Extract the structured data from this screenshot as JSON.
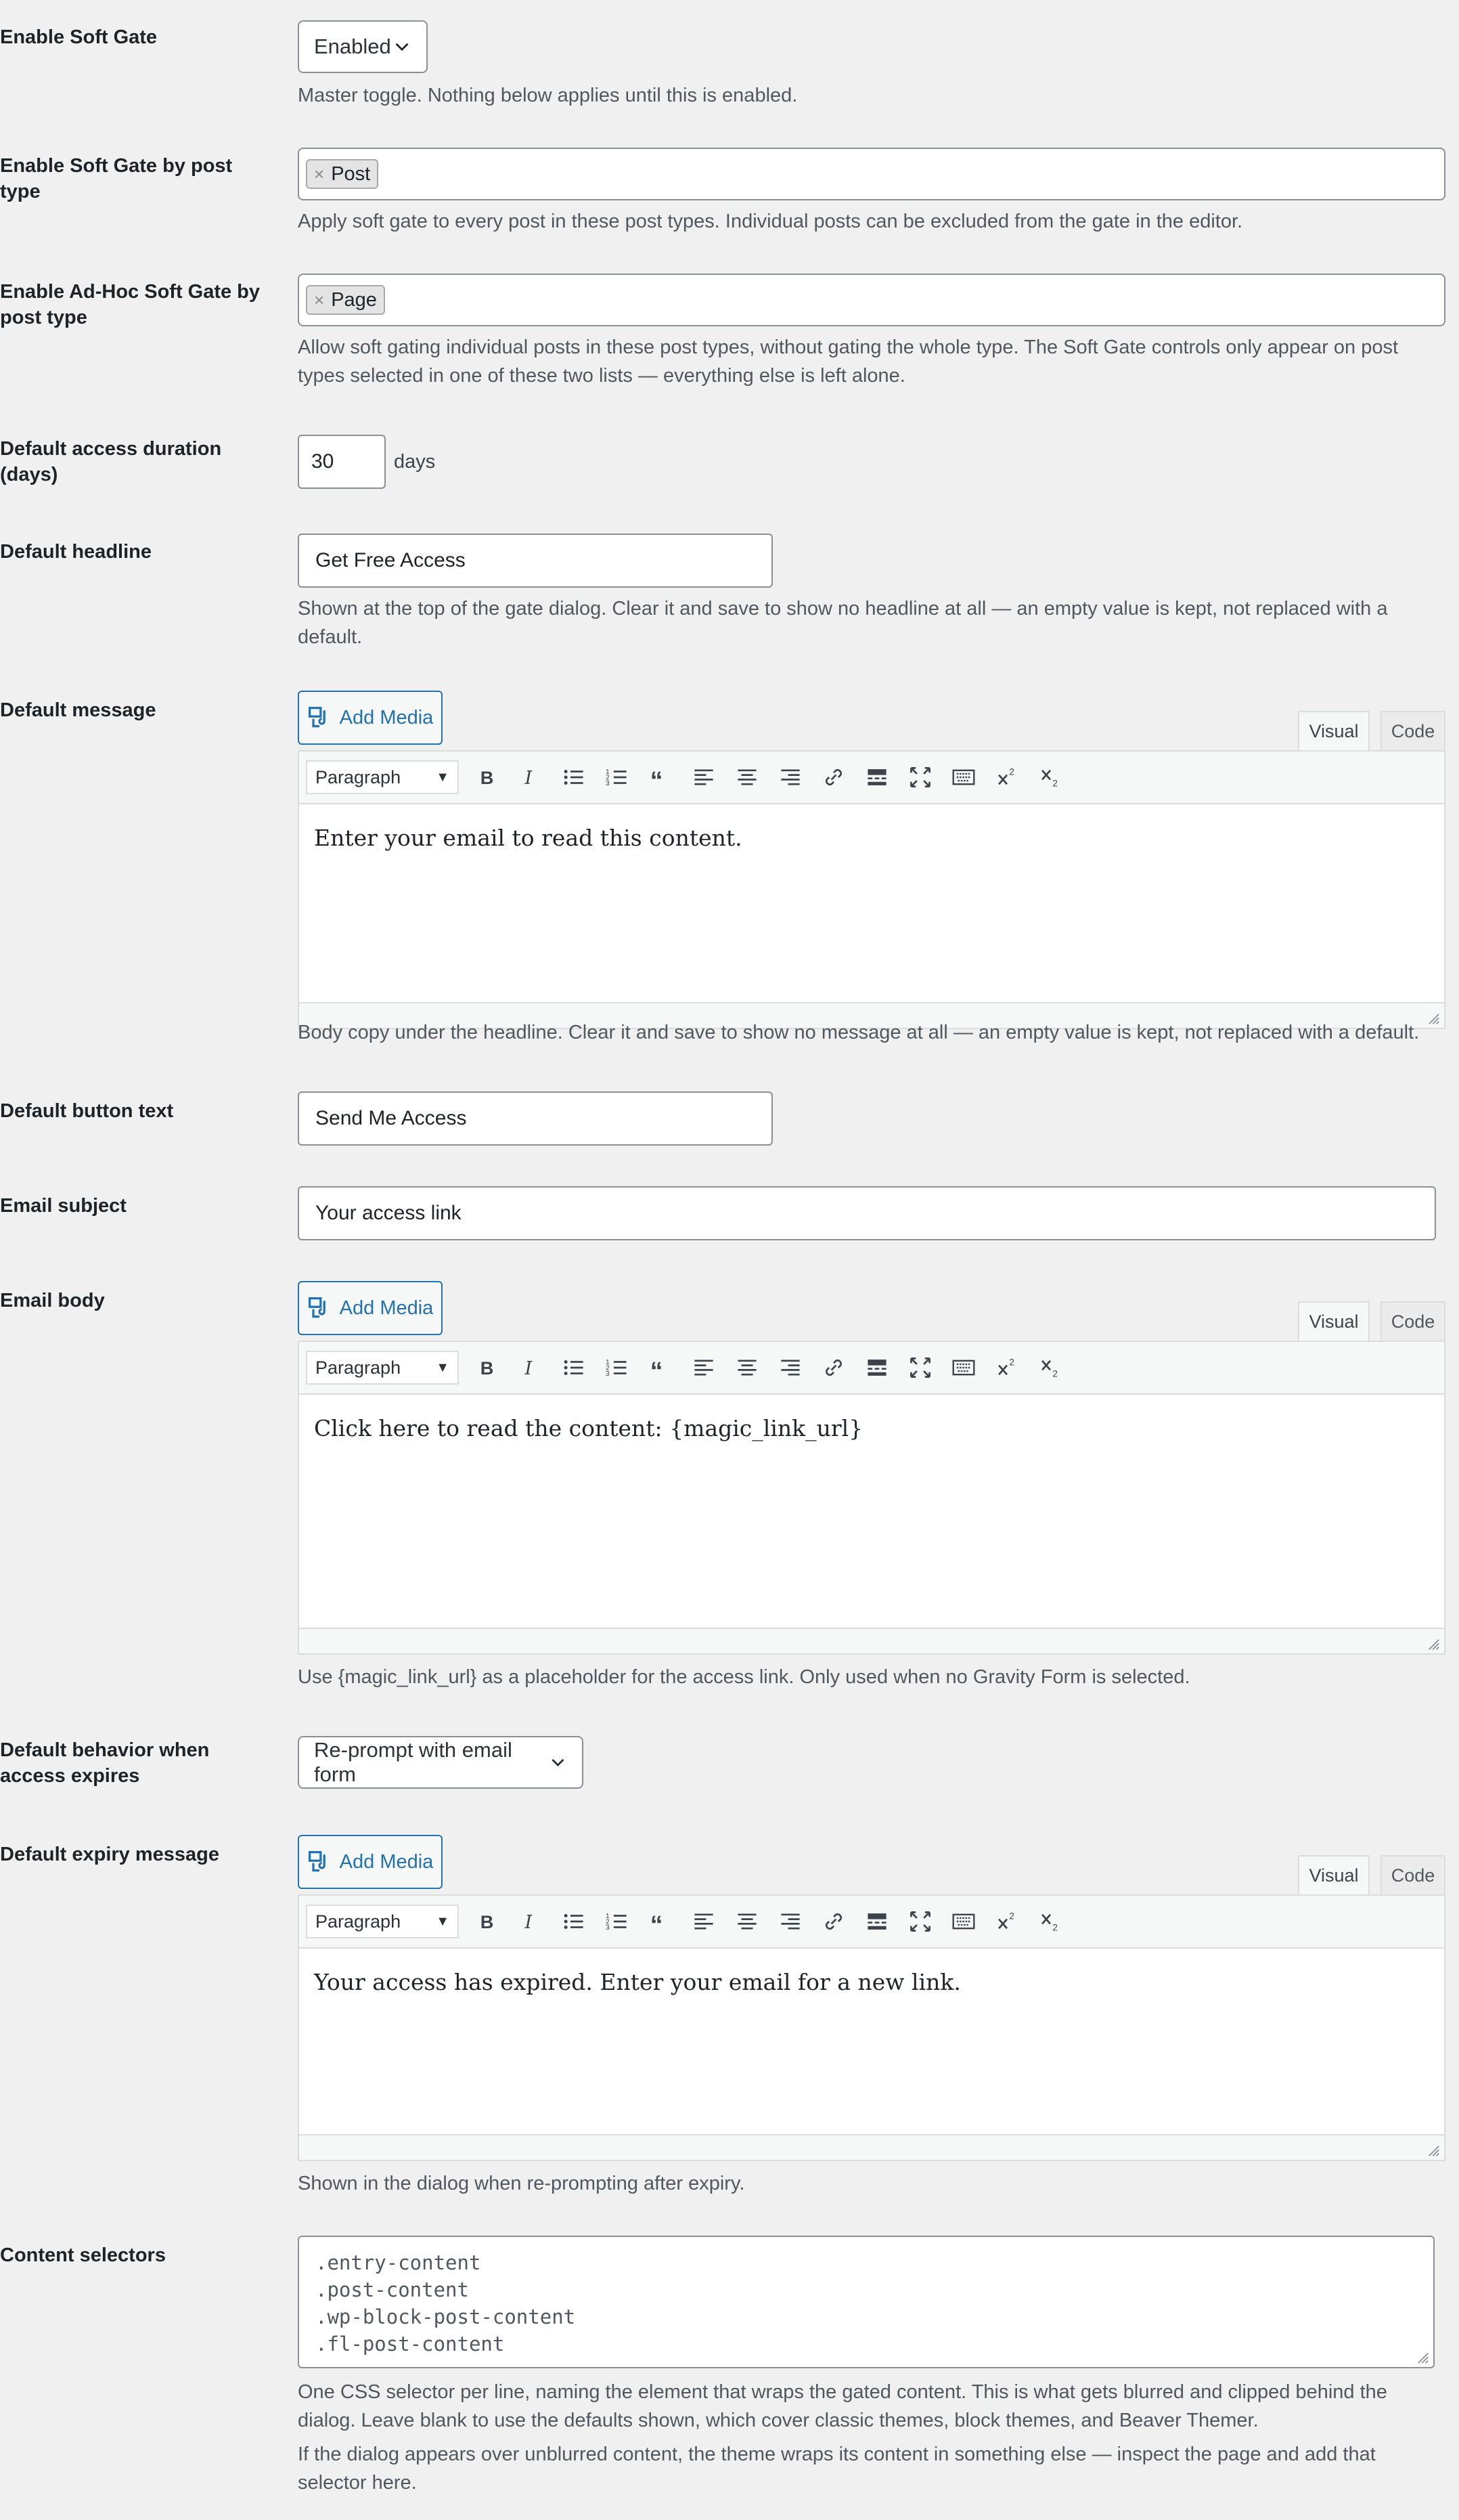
{
  "enable_soft_gate": {
    "label": "Enable Soft Gate",
    "value": "Enabled",
    "desc": "Master toggle. Nothing below applies until this is enabled."
  },
  "post_type_gate": {
    "label": "Enable Soft Gate by post type",
    "tokens": [
      "Post"
    ],
    "desc": "Apply soft gate to every post in these post types. Individual posts can be excluded from the gate in the editor."
  },
  "adhoc_gate": {
    "label": "Enable Ad-Hoc Soft Gate by post type",
    "tokens": [
      "Page"
    ],
    "desc": "Allow soft gating individual posts in these post types, without gating the whole type. The Soft Gate controls only appear on post types selected in one of these two lists — everything else is left alone."
  },
  "duration": {
    "label": "Default access duration (days)",
    "value": "30",
    "unit": "days"
  },
  "headline": {
    "label": "Default headline",
    "value": "Get Free Access",
    "desc": "Shown at the top of the gate dialog. Clear it and save to show no headline at all — an empty value is kept, not replaced with a default."
  },
  "message": {
    "label": "Default message",
    "content": "Enter your email to read this content.",
    "desc": "Body copy under the headline. Clear it and save to show no message at all — an empty value is kept, not replaced with a default."
  },
  "button_text": {
    "label": "Default button text",
    "value": "Send Me Access"
  },
  "email_subject": {
    "label": "Email subject",
    "value": "Your access link"
  },
  "email_body": {
    "label": "Email body",
    "content": "Click here to read the content: {magic_link_url}",
    "desc": "Use {magic_link_url} as a placeholder for the access link. Only used when no Gravity Form is selected."
  },
  "expiry_behavior": {
    "label": "Default behavior when access expires",
    "value": "Re-prompt with email form"
  },
  "expiry_message": {
    "label": "Default expiry message",
    "content": "Your access has expired. Enter your email for a new link.",
    "desc": "Shown in the dialog when re-prompting after expiry."
  },
  "content_selectors": {
    "label": "Content selectors",
    "lines": [
      ".entry-content",
      ".post-content",
      ".wp-block-post-content",
      ".fl-post-content"
    ],
    "desc1": "One CSS selector per line, naming the element that wraps the gated content. This is what gets blurred and clipped behind the dialog. Leave blank to use the defaults shown, which cover classic themes, block themes, and Beaver Themer.",
    "desc2": "If the dialog appears over unblurred content, the theme wraps its content in something else — inspect the page and add that selector here."
  },
  "editor": {
    "add_media": "Add Media",
    "tab_visual": "Visual",
    "tab_code": "Code",
    "format": "Paragraph",
    "icons": [
      "bold-icon",
      "italic-icon",
      "bullet-list-icon",
      "numbered-list-icon",
      "blockquote-icon",
      "align-left-icon",
      "align-center-icon",
      "align-right-icon",
      "link-icon",
      "read-more-icon",
      "fullscreen-icon",
      "keyboard-icon",
      "superscript-icon",
      "subscript-icon"
    ]
  }
}
